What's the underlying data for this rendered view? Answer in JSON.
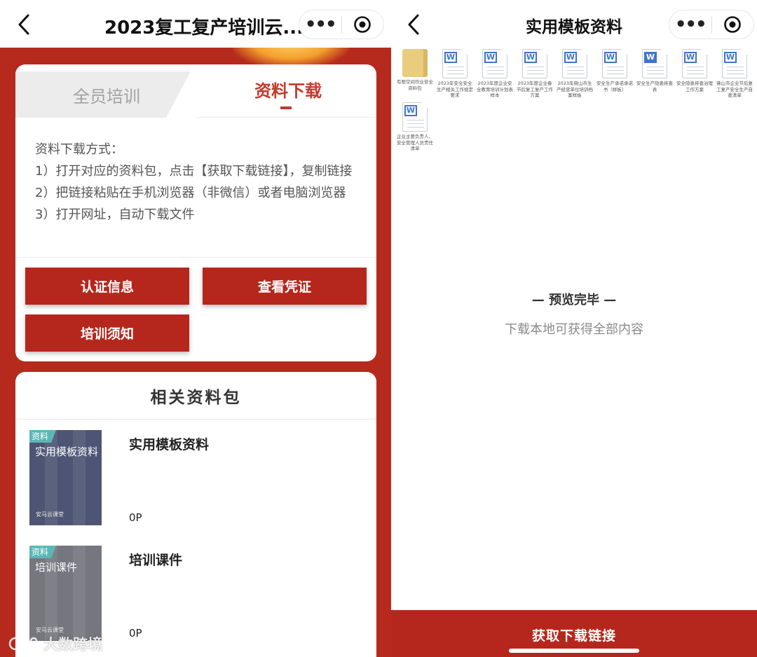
{
  "left": {
    "nav": {
      "title": "2023复工复产培训云..."
    },
    "tabs": {
      "tab1": "全员培训",
      "tab2": "资料下载"
    },
    "instructions": {
      "line0": "资料下载方式：",
      "line1": "1）打开对应的资料包，点击【获取下载链接】，复制链接",
      "line2": "2）把链接粘贴在手机浏览器（非微信）或者电脑浏览器",
      "line3": "3）打开网址，自动下载文件"
    },
    "buttons": {
      "auth": "认证信息",
      "cert": "查看凭证",
      "notice": "培训须知"
    },
    "packages": {
      "header": "相关资料包",
      "items": [
        {
          "title": "实用模板资料",
          "cover_badge": "资料",
          "cover_title": "实用模板资料",
          "cover_brand": "安马云课堂",
          "pages": "0P",
          "cover_color": "#4e5574"
        },
        {
          "title": "培训课件",
          "cover_badge": "资料",
          "cover_title": "培训课件",
          "cover_brand": "安马云课堂",
          "pages": "0P",
          "cover_color": "#75767e"
        }
      ]
    },
    "watermark": "大数跨境"
  },
  "right": {
    "nav": {
      "title": "实用模板资料"
    },
    "files": [
      {
        "type": "folder",
        "name": "有限空间作业安全资料包"
      },
      {
        "type": "word",
        "name": "2023年安全安全生产相关工作规定要求"
      },
      {
        "type": "word",
        "name": "2023年度企业安全教育培训计划表样本"
      },
      {
        "type": "word",
        "name": "2023年度企业春节后复工复产工作方案"
      },
      {
        "type": "word",
        "name": "2023年佛山市生产经营单位培训档案样板"
      },
      {
        "type": "word",
        "name": "安全生产承诺承诺书（样板）"
      },
      {
        "type": "word-dark",
        "name": "安全生产隐患排查表"
      },
      {
        "type": "word",
        "name": "安全隐患排查治理工作方案"
      },
      {
        "type": "word",
        "name": "佛山市企业节后复工复产安全生产自查清单"
      },
      {
        "type": "word",
        "name": "企业主要负责人、安全管理人员责任清单"
      }
    ],
    "preview_end": "— 预览完毕 —",
    "preview_sub": "下载本地可获得全部内容",
    "footer_button": "获取下载链接"
  }
}
